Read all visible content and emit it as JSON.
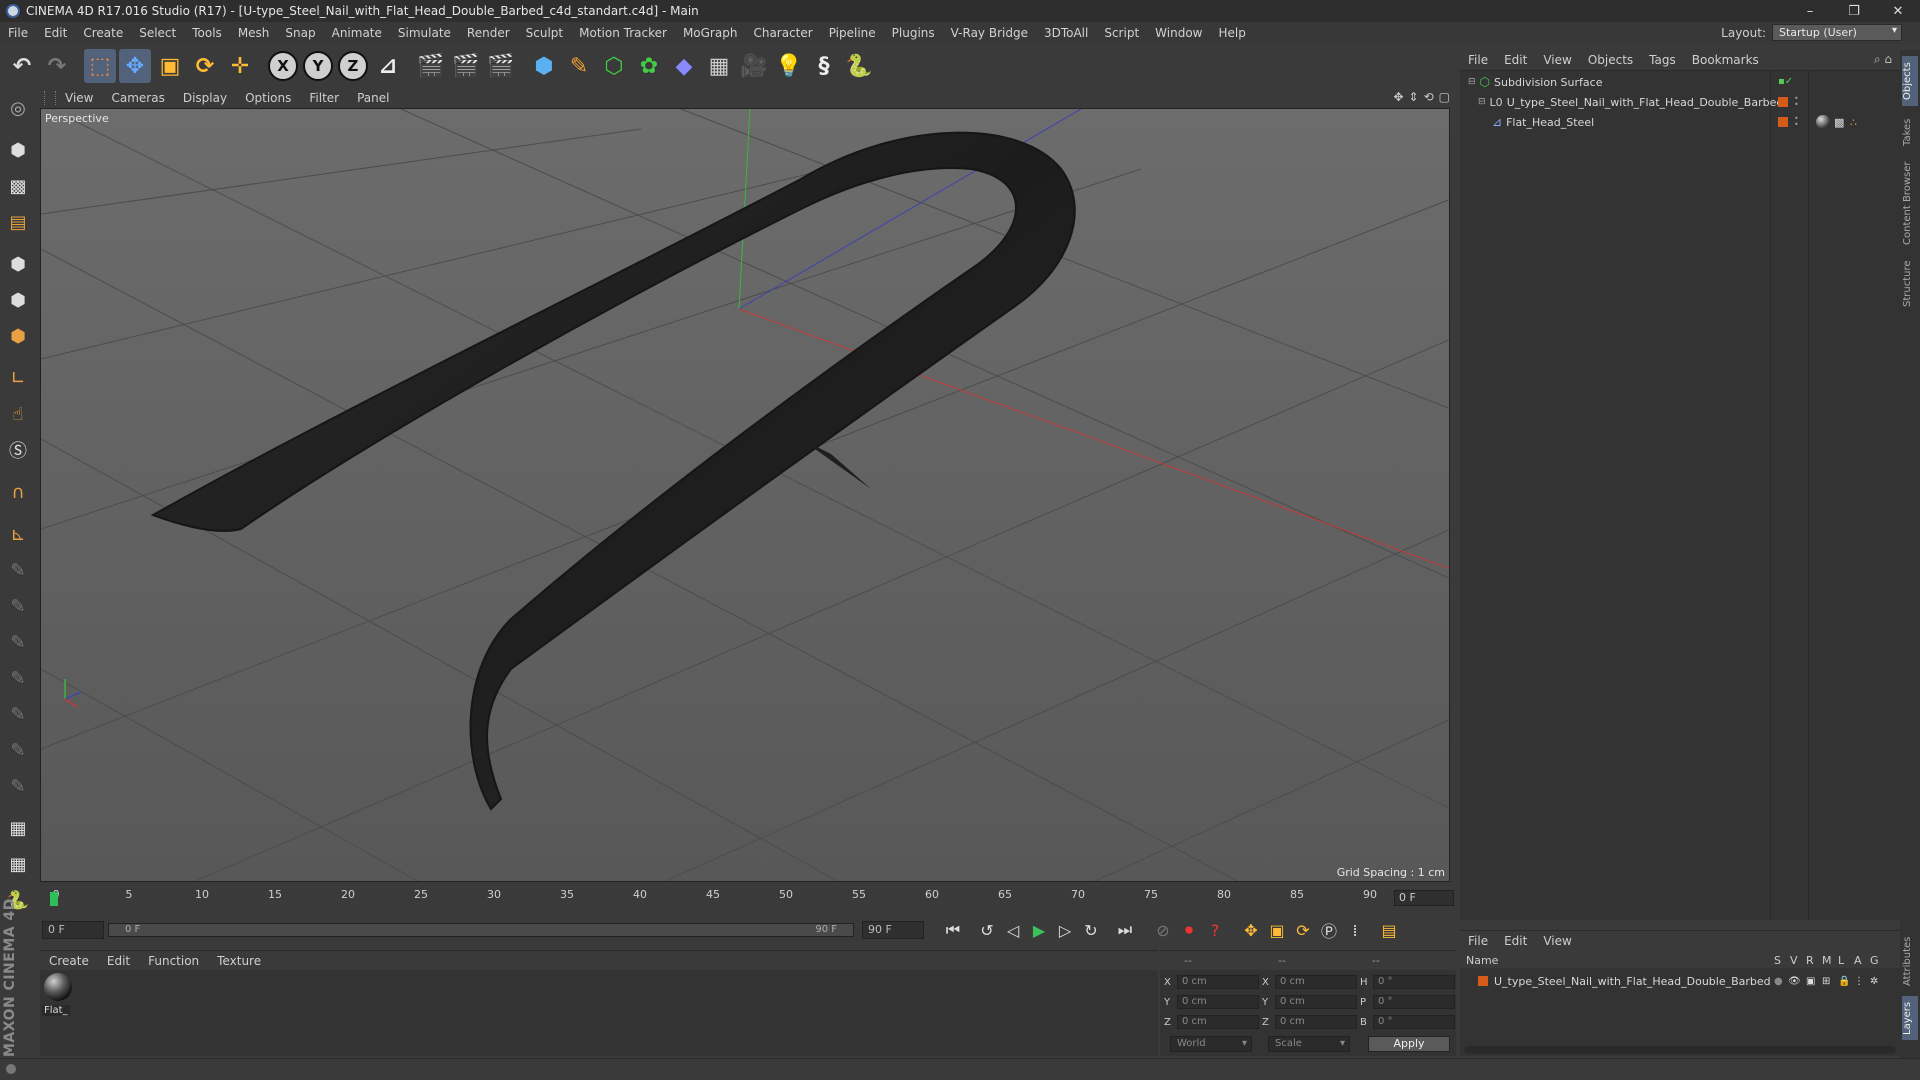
{
  "window": {
    "title": "CINEMA 4D R17.016 Studio (R17) - [U-type_Steel_Nail_with_Flat_Head_Double_Barbed_c4d_standart.c4d] - Main",
    "controls": [
      "–",
      "❐",
      "✕"
    ]
  },
  "menu": [
    "File",
    "Edit",
    "Create",
    "Select",
    "Tools",
    "Mesh",
    "Snap",
    "Animate",
    "Simulate",
    "Render",
    "Sculpt",
    "Motion Tracker",
    "MoGraph",
    "Character",
    "Pipeline",
    "Plugins",
    "V-Ray Bridge",
    "3DToAll",
    "Script",
    "Window",
    "Help"
  ],
  "layout": {
    "label": "Layout:",
    "value": "Startup (User)"
  },
  "toolbar": {
    "axis_x": "X",
    "axis_y": "Y",
    "axis_z": "Z"
  },
  "viewport": {
    "menu": [
      "View",
      "Cameras",
      "Display",
      "Options",
      "Filter",
      "Panel"
    ],
    "camera": "Perspective",
    "grid_spacing": "Grid Spacing : 1 cm",
    "nav_icons": [
      "✥",
      "⇕",
      "⟲",
      "▢"
    ]
  },
  "timeline": {
    "ticks": [
      "0",
      "5",
      "10",
      "15",
      "20",
      "25",
      "30",
      "35",
      "40",
      "45",
      "50",
      "55",
      "60",
      "65",
      "70",
      "75",
      "80",
      "85",
      "90"
    ],
    "current_frame": "0 F"
  },
  "playback": {
    "start": "0 F",
    "range_start": "0 F",
    "range_end": "90 F",
    "end": "90 F"
  },
  "materials": {
    "menu": [
      "Create",
      "Edit",
      "Function",
      "Texture"
    ],
    "items": [
      "Flat_"
    ]
  },
  "coordinates": {
    "head": [
      "--",
      "--",
      "--"
    ],
    "rows": [
      {
        "axis": "X",
        "pos": "0 cm",
        "axis2": "X",
        "size": "0 cm",
        "rot_label": "H",
        "rot": "0 °"
      },
      {
        "axis": "Y",
        "pos": "0 cm",
        "axis2": "Y",
        "size": "0 cm",
        "rot_label": "P",
        "rot": "0 °"
      },
      {
        "axis": "Z",
        "pos": "0 cm",
        "axis2": "Z",
        "size": "0 cm",
        "rot_label": "B",
        "rot": "0 °"
      }
    ],
    "mode": "World",
    "transform": "Scale",
    "apply": "Apply"
  },
  "object_manager": {
    "menu": [
      "File",
      "Edit",
      "View",
      "Objects",
      "Tags",
      "Bookmarks"
    ],
    "objects": [
      {
        "name": "Subdivision Surface"
      },
      {
        "name": "U_type_Steel_Nail_with_Flat_Head_Double_Barbed"
      },
      {
        "name": "Flat_Head_Steel"
      }
    ]
  },
  "right_tabs": [
    "Objects",
    "Takes",
    "Content Browser",
    "Structure",
    "Attributes",
    "Layers"
  ],
  "layer_manager": {
    "menu": [
      "File",
      "Edit",
      "View"
    ],
    "columns": [
      "Name",
      "S",
      "V",
      "R",
      "M",
      "L",
      "A",
      "G"
    ],
    "layers": [
      {
        "name": "U_type_Steel_Nail_with_Flat_Head_Double_Barbed"
      }
    ]
  },
  "brand": "MAXON CINEMA 4D",
  "colors": {
    "accent": "#51627a",
    "tag_orange": "#d65a1a",
    "viewport_bg": "#636363"
  }
}
